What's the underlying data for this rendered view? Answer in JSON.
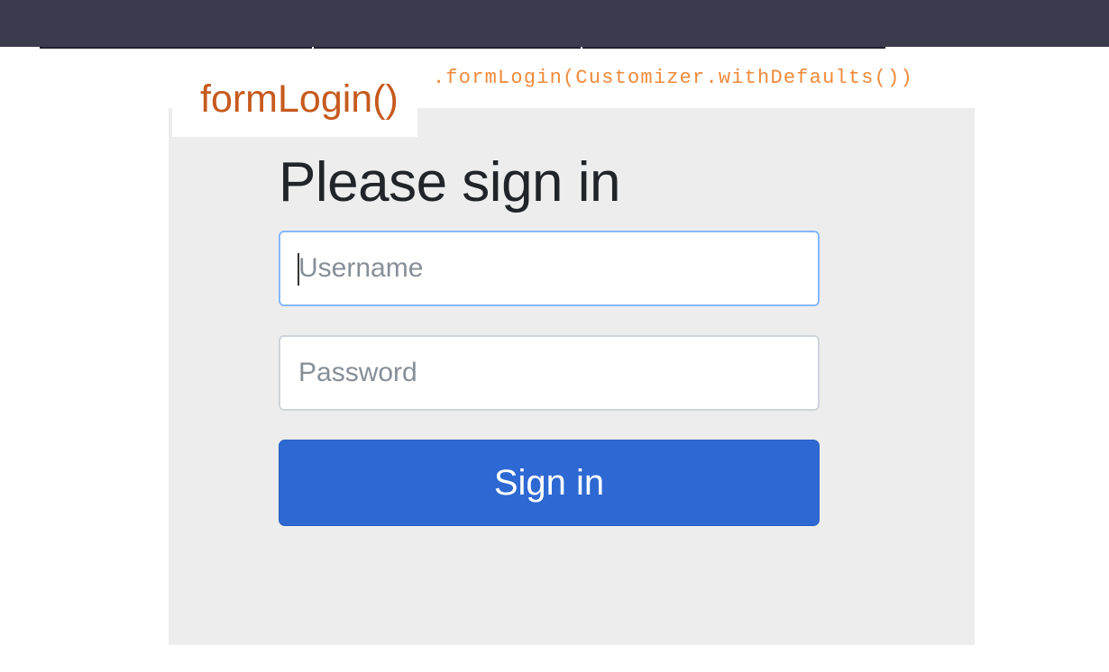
{
  "code": {
    "snippet": ".formLogin(Customizer.withDefaults())",
    "method_label": "formLogin()"
  },
  "form": {
    "heading": "Please sign in",
    "username_placeholder": "Username",
    "password_placeholder": "Password",
    "submit_label": "Sign in"
  },
  "colors": {
    "top_bar": "#3a3b4c",
    "panel": "#ededed",
    "code_snippet": "#f08a3a",
    "method_label": "#c65a1e",
    "submit_button": "#2e69d3",
    "input_focus_border": "#86b7fe"
  }
}
